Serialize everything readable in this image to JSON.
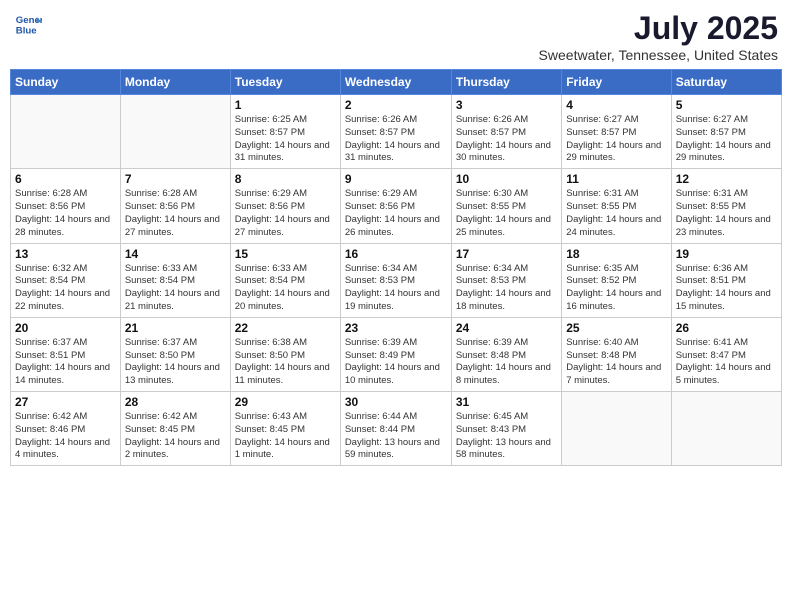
{
  "logo": {
    "line1": "General",
    "line2": "Blue"
  },
  "title": "July 2025",
  "location": "Sweetwater, Tennessee, United States",
  "days_of_week": [
    "Sunday",
    "Monday",
    "Tuesday",
    "Wednesday",
    "Thursday",
    "Friday",
    "Saturday"
  ],
  "weeks": [
    [
      {
        "day": "",
        "info": ""
      },
      {
        "day": "",
        "info": ""
      },
      {
        "day": "1",
        "info": "Sunrise: 6:25 AM\nSunset: 8:57 PM\nDaylight: 14 hours and 31 minutes."
      },
      {
        "day": "2",
        "info": "Sunrise: 6:26 AM\nSunset: 8:57 PM\nDaylight: 14 hours and 31 minutes."
      },
      {
        "day": "3",
        "info": "Sunrise: 6:26 AM\nSunset: 8:57 PM\nDaylight: 14 hours and 30 minutes."
      },
      {
        "day": "4",
        "info": "Sunrise: 6:27 AM\nSunset: 8:57 PM\nDaylight: 14 hours and 29 minutes."
      },
      {
        "day": "5",
        "info": "Sunrise: 6:27 AM\nSunset: 8:57 PM\nDaylight: 14 hours and 29 minutes."
      }
    ],
    [
      {
        "day": "6",
        "info": "Sunrise: 6:28 AM\nSunset: 8:56 PM\nDaylight: 14 hours and 28 minutes."
      },
      {
        "day": "7",
        "info": "Sunrise: 6:28 AM\nSunset: 8:56 PM\nDaylight: 14 hours and 27 minutes."
      },
      {
        "day": "8",
        "info": "Sunrise: 6:29 AM\nSunset: 8:56 PM\nDaylight: 14 hours and 27 minutes."
      },
      {
        "day": "9",
        "info": "Sunrise: 6:29 AM\nSunset: 8:56 PM\nDaylight: 14 hours and 26 minutes."
      },
      {
        "day": "10",
        "info": "Sunrise: 6:30 AM\nSunset: 8:55 PM\nDaylight: 14 hours and 25 minutes."
      },
      {
        "day": "11",
        "info": "Sunrise: 6:31 AM\nSunset: 8:55 PM\nDaylight: 14 hours and 24 minutes."
      },
      {
        "day": "12",
        "info": "Sunrise: 6:31 AM\nSunset: 8:55 PM\nDaylight: 14 hours and 23 minutes."
      }
    ],
    [
      {
        "day": "13",
        "info": "Sunrise: 6:32 AM\nSunset: 8:54 PM\nDaylight: 14 hours and 22 minutes."
      },
      {
        "day": "14",
        "info": "Sunrise: 6:33 AM\nSunset: 8:54 PM\nDaylight: 14 hours and 21 minutes."
      },
      {
        "day": "15",
        "info": "Sunrise: 6:33 AM\nSunset: 8:54 PM\nDaylight: 14 hours and 20 minutes."
      },
      {
        "day": "16",
        "info": "Sunrise: 6:34 AM\nSunset: 8:53 PM\nDaylight: 14 hours and 19 minutes."
      },
      {
        "day": "17",
        "info": "Sunrise: 6:34 AM\nSunset: 8:53 PM\nDaylight: 14 hours and 18 minutes."
      },
      {
        "day": "18",
        "info": "Sunrise: 6:35 AM\nSunset: 8:52 PM\nDaylight: 14 hours and 16 minutes."
      },
      {
        "day": "19",
        "info": "Sunrise: 6:36 AM\nSunset: 8:51 PM\nDaylight: 14 hours and 15 minutes."
      }
    ],
    [
      {
        "day": "20",
        "info": "Sunrise: 6:37 AM\nSunset: 8:51 PM\nDaylight: 14 hours and 14 minutes."
      },
      {
        "day": "21",
        "info": "Sunrise: 6:37 AM\nSunset: 8:50 PM\nDaylight: 14 hours and 13 minutes."
      },
      {
        "day": "22",
        "info": "Sunrise: 6:38 AM\nSunset: 8:50 PM\nDaylight: 14 hours and 11 minutes."
      },
      {
        "day": "23",
        "info": "Sunrise: 6:39 AM\nSunset: 8:49 PM\nDaylight: 14 hours and 10 minutes."
      },
      {
        "day": "24",
        "info": "Sunrise: 6:39 AM\nSunset: 8:48 PM\nDaylight: 14 hours and 8 minutes."
      },
      {
        "day": "25",
        "info": "Sunrise: 6:40 AM\nSunset: 8:48 PM\nDaylight: 14 hours and 7 minutes."
      },
      {
        "day": "26",
        "info": "Sunrise: 6:41 AM\nSunset: 8:47 PM\nDaylight: 14 hours and 5 minutes."
      }
    ],
    [
      {
        "day": "27",
        "info": "Sunrise: 6:42 AM\nSunset: 8:46 PM\nDaylight: 14 hours and 4 minutes."
      },
      {
        "day": "28",
        "info": "Sunrise: 6:42 AM\nSunset: 8:45 PM\nDaylight: 14 hours and 2 minutes."
      },
      {
        "day": "29",
        "info": "Sunrise: 6:43 AM\nSunset: 8:45 PM\nDaylight: 14 hours and 1 minute."
      },
      {
        "day": "30",
        "info": "Sunrise: 6:44 AM\nSunset: 8:44 PM\nDaylight: 13 hours and 59 minutes."
      },
      {
        "day": "31",
        "info": "Sunrise: 6:45 AM\nSunset: 8:43 PM\nDaylight: 13 hours and 58 minutes."
      },
      {
        "day": "",
        "info": ""
      },
      {
        "day": "",
        "info": ""
      }
    ]
  ]
}
